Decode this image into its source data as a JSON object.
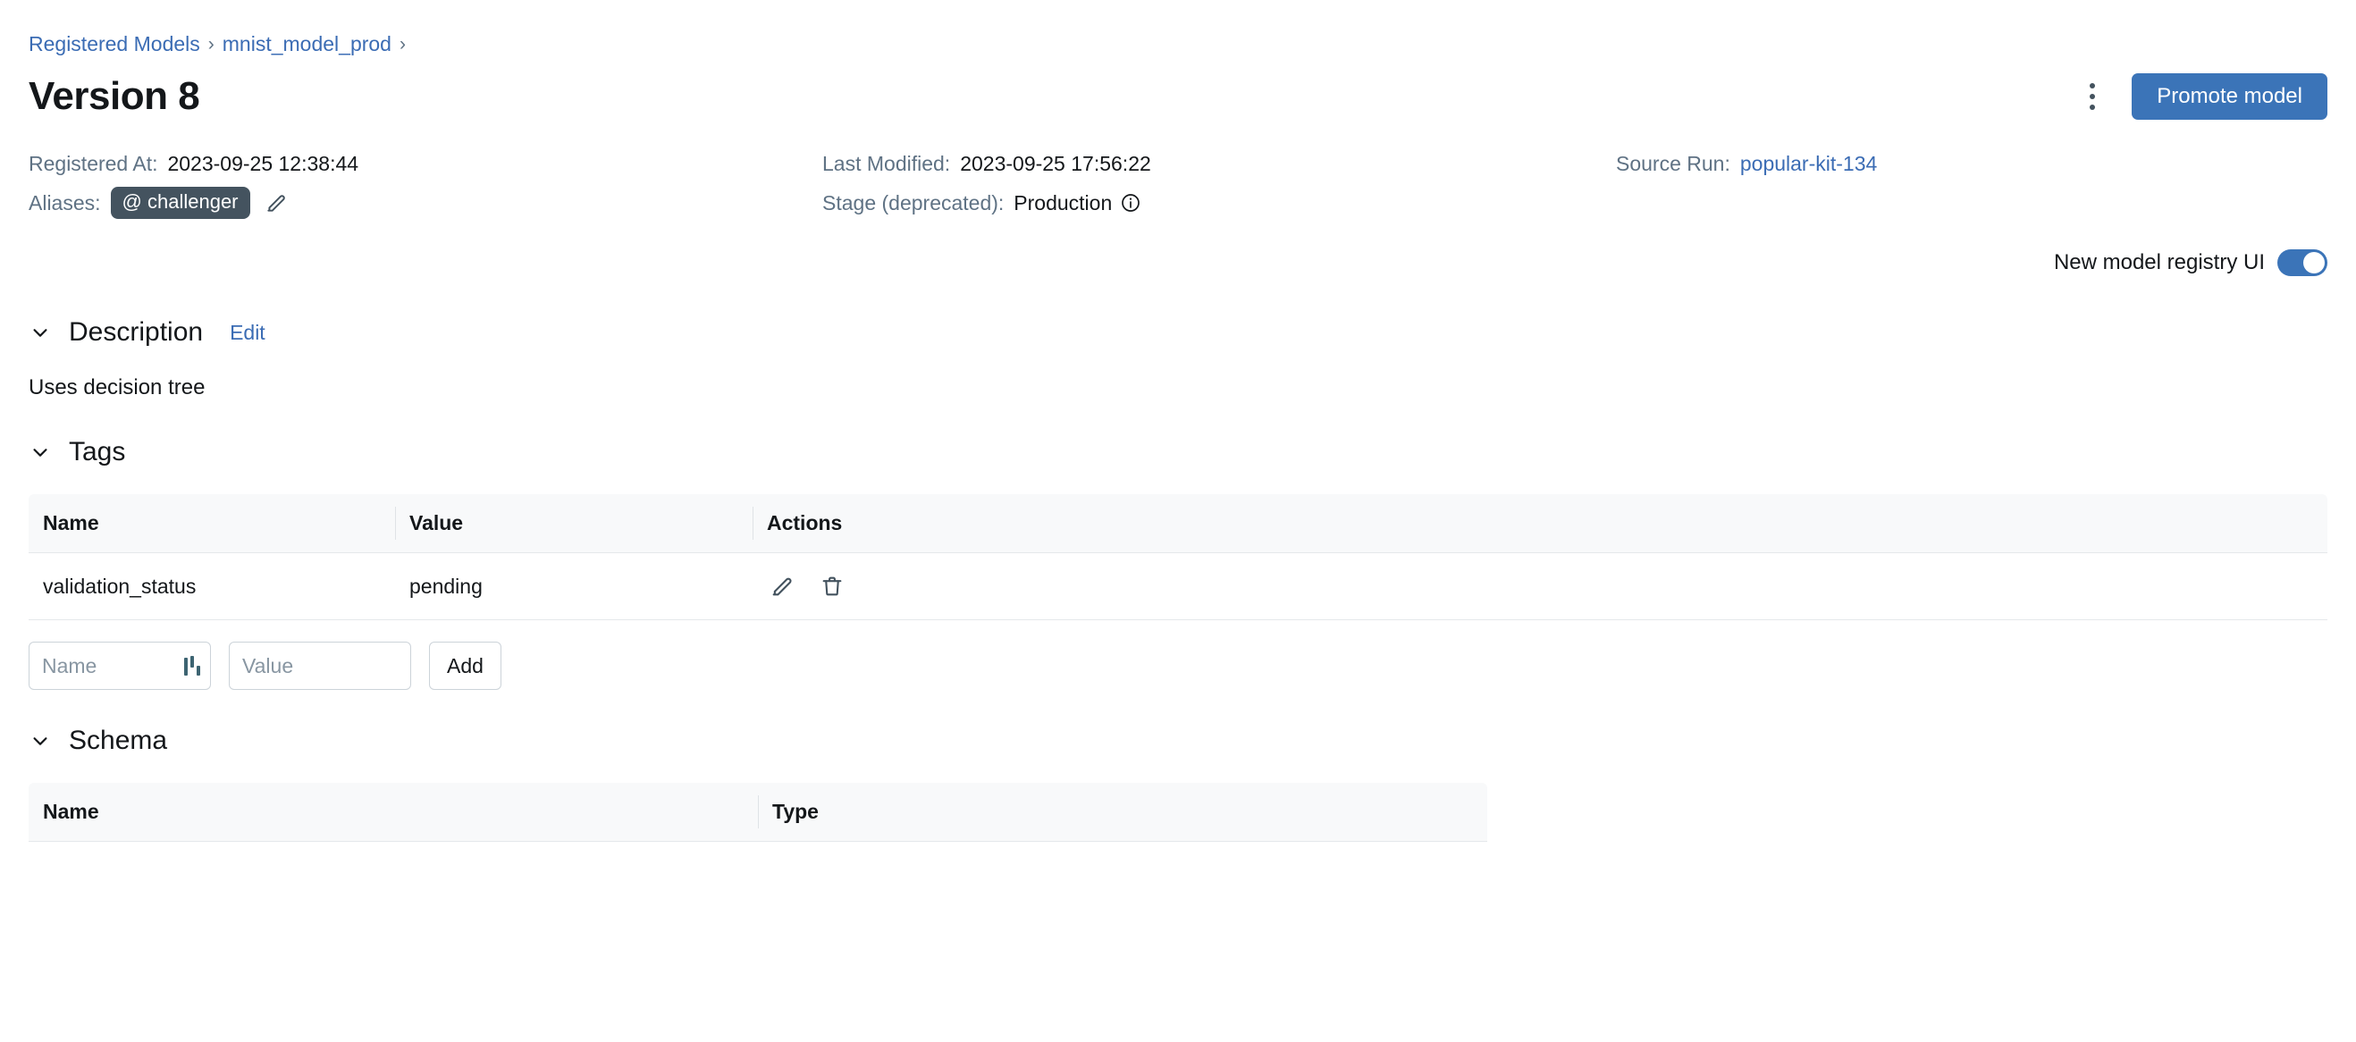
{
  "breadcrumb": {
    "items": [
      {
        "label": "Registered Models",
        "type": "link"
      },
      {
        "label": "mnist_model_prod",
        "type": "link"
      }
    ],
    "separator": "›"
  },
  "header": {
    "title": "Version 8",
    "kebab_label": "More options",
    "promote_label": "Promote model"
  },
  "meta": {
    "registered_at_label": "Registered At:",
    "registered_at_value": "2023-09-25 12:38:44",
    "last_modified_label": "Last Modified:",
    "last_modified_value": "2023-09-25 17:56:22",
    "source_run_label": "Source Run:",
    "source_run_value": "popular-kit-134",
    "aliases_label": "Aliases:",
    "alias_chip": "@ challenger",
    "stage_label": "Stage (deprecated):",
    "stage_value": "Production"
  },
  "toggle": {
    "label": "New model registry UI",
    "on": true
  },
  "description": {
    "title": "Description",
    "edit_label": "Edit",
    "body": "Uses decision tree"
  },
  "tags": {
    "title": "Tags",
    "columns": [
      "Name",
      "Value",
      "Actions"
    ],
    "rows": [
      {
        "name": "validation_status",
        "value": "pending"
      }
    ],
    "form": {
      "name_placeholder": "Name",
      "value_placeholder": "Value",
      "name_value": "",
      "value_value": "",
      "add_label": "Add"
    }
  },
  "schema": {
    "title": "Schema",
    "columns": [
      "Name",
      "Type"
    ]
  },
  "colors": {
    "accent": "#3b74b8",
    "link": "#3b6cb4",
    "chip": "#44535f",
    "muted": "#5f7284",
    "table_header_bg": "#f8f9fa",
    "border": "#e5e8eb"
  }
}
